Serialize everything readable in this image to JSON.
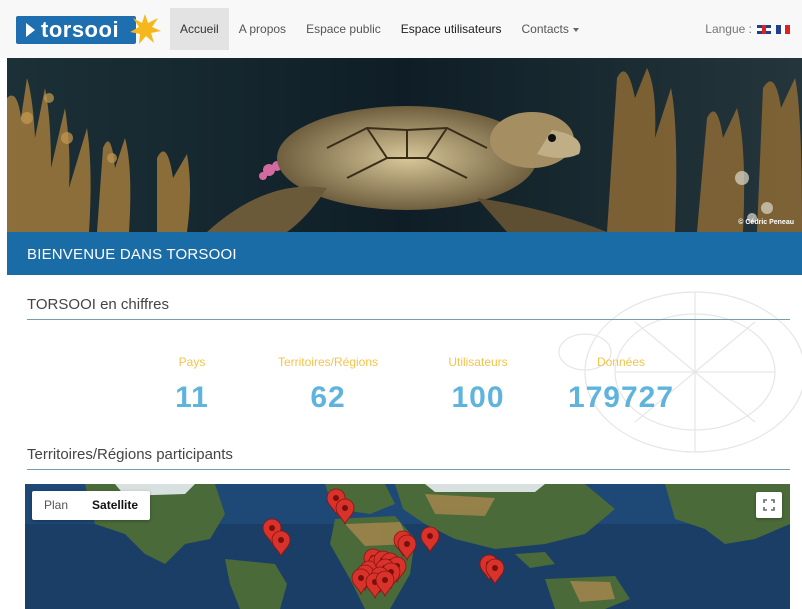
{
  "brand": {
    "logo_text": "torsooi"
  },
  "nav": {
    "items": [
      {
        "label": "Accueil",
        "active": true,
        "bold": false
      },
      {
        "label": "A propos",
        "active": false,
        "bold": false
      },
      {
        "label": "Espace public",
        "active": false,
        "bold": false
      },
      {
        "label": "Espace utilisateurs",
        "active": false,
        "bold": true
      },
      {
        "label": "Contacts",
        "active": false,
        "bold": false,
        "dropdown": true
      }
    ],
    "language_label": "Langue :"
  },
  "hero": {
    "credit": "© Cédric Peneau"
  },
  "banner": {
    "title": "BIENVENUE DANS TORSOOI"
  },
  "stats_section": {
    "title": "TORSOOI en chiffres",
    "items": [
      {
        "label": "Pays",
        "value": "11"
      },
      {
        "label": "Territoires/Régions",
        "value": "62"
      },
      {
        "label": "Utilisateurs",
        "value": "100"
      },
      {
        "label": "Données",
        "value": "179727"
      }
    ]
  },
  "map_section": {
    "title": "Territoires/Régions participants",
    "map_type_plan": "Plan",
    "map_type_satellite": "Satellite",
    "marker_count_visible": 22
  },
  "colors": {
    "brand_blue": "#1a6ca7",
    "stat_label": "#f4c34a",
    "stat_value": "#5fb4de",
    "marker_red": "#d8322b"
  }
}
